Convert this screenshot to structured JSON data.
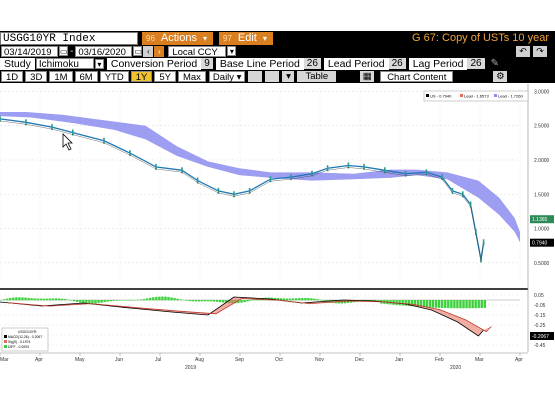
{
  "header": {
    "ticker": "USGG10YR Index",
    "actions_label": "Actions",
    "edit_label": "Edit",
    "window_title": "G 67: Copy of USTs 10 year"
  },
  "dates": {
    "start": "03/14/2019",
    "end": "03/16/2020",
    "currency": "Local CCY"
  },
  "study": {
    "label": "Study",
    "value": "Ichimoku",
    "conversion_label": "Conversion Period",
    "conversion_value": "9",
    "base_label": "Base Line Period",
    "base_value": "26",
    "lead_label": "Lead Period",
    "lead_value": "26",
    "lag_label": "Lag Period",
    "lag_value": "26"
  },
  "toolbar": {
    "periods": [
      "1D",
      "3D",
      "1M",
      "6M",
      "YTD",
      "1Y",
      "5Y",
      "Max"
    ],
    "active_period": "1Y",
    "frequency": "Daily",
    "table_label": "Table",
    "chart_content_label": "Chart Content"
  },
  "chart_data": [
    {
      "type": "line",
      "title": "",
      "y_ticks": [
        "3.0000",
        "2.5000",
        "2.0000",
        "1.5000",
        "1.0000",
        "0.5000"
      ],
      "legend": [
        "US - 0.7940",
        "Lead - 1.6573",
        "Lead - 1.7260"
      ],
      "last_values": [
        {
          "label": "1.1365",
          "color": "#2e8b57"
        },
        {
          "label": "0.7940",
          "color": "#000000"
        }
      ],
      "x_ticks": [
        "Mar",
        "Apr",
        "May",
        "Jun",
        "Jul",
        "Aug",
        "Sep",
        "Oct",
        "Nov",
        "Dec",
        "Jan",
        "Feb",
        "Mar",
        "Apr"
      ],
      "years": [
        "2019",
        "2020"
      ],
      "price_series": {
        "name": "",
        "x": [
          0,
          0.05,
          0.1,
          0.14,
          0.2,
          0.25,
          0.3,
          0.35,
          0.38,
          0.42,
          0.45,
          0.48,
          0.52,
          0.56,
          0.6,
          0.63,
          0.67,
          0.7,
          0.74,
          0.78,
          0.82,
          0.85,
          0.87,
          0.89,
          0.905,
          0.915,
          0.925,
          0.93
        ],
        "y": [
          2.6,
          2.55,
          2.48,
          2.4,
          2.28,
          2.1,
          1.9,
          1.85,
          1.7,
          1.55,
          1.5,
          1.55,
          1.72,
          1.75,
          1.8,
          1.88,
          1.92,
          1.9,
          1.85,
          1.8,
          1.82,
          1.75,
          1.55,
          1.5,
          1.35,
          0.95,
          0.55,
          0.8
        ]
      }
    },
    {
      "type": "line",
      "title": "",
      "y_ticks": [
        "0.05",
        "-0.05",
        "-0.15",
        "-0.25",
        "-0.35",
        "-0.45"
      ],
      "legend": [
        "USGG10YR",
        "MACD(12,26) - 0.2067",
        "Sig(9) - 0.1974",
        "DIFF - 0.0093"
      ],
      "last_values": [
        {
          "label": "-0.2067",
          "color": "#000000"
        }
      ]
    }
  ]
}
